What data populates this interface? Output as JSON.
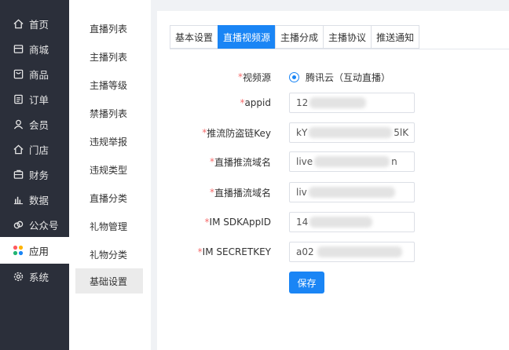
{
  "nav": {
    "items": [
      {
        "label": "首页",
        "icon": "home-icon"
      },
      {
        "label": "商城",
        "icon": "store-icon"
      },
      {
        "label": "商品",
        "icon": "product-icon"
      },
      {
        "label": "订单",
        "icon": "order-icon"
      },
      {
        "label": "会员",
        "icon": "user-icon"
      },
      {
        "label": "门店",
        "icon": "shop-icon"
      },
      {
        "label": "财务",
        "icon": "finance-icon"
      },
      {
        "label": "数据",
        "icon": "chart-icon"
      },
      {
        "label": "公众号",
        "icon": "link-icon"
      },
      {
        "label": "应用",
        "icon": "apps-icon"
      },
      {
        "label": "系统",
        "icon": "gear-icon"
      }
    ],
    "active_index": 9
  },
  "subnav": {
    "items": [
      "直播列表",
      "主播列表",
      "主播等级",
      "禁播列表",
      "违规举报",
      "违规类型",
      "直播分类",
      "礼物管理",
      "礼物分类",
      "基础设置"
    ],
    "active_index": 9
  },
  "tabs": {
    "items": [
      "基本设置",
      "直播视频源",
      "主播分成",
      "主播协议",
      "推送通知"
    ],
    "active_index": 1
  },
  "form": {
    "required_mark": "*",
    "video_source_label": "视频源",
    "video_source_option": "腾讯云（互动直播）",
    "appid_label": "appid",
    "appid_value": "12",
    "push_key_label": "推流防盗链Key",
    "push_key_value_start": "kY",
    "push_key_value_end": "5lK",
    "push_domain_label": "直播推流域名",
    "push_domain_value_start": "live",
    "push_domain_value_end": "n",
    "play_domain_label": "直播播流域名",
    "play_domain_value": "liv",
    "sdk_appid_label": "IM SDKAppID",
    "sdk_appid_value": "14",
    "secret_key_label": "IM SECRETKEY",
    "secret_key_value": "a02",
    "save_label": "保存"
  },
  "colors": {
    "sidebar_bg": "#2b2f3a",
    "accent": "#1a85f5",
    "required": "#f56c6c"
  }
}
